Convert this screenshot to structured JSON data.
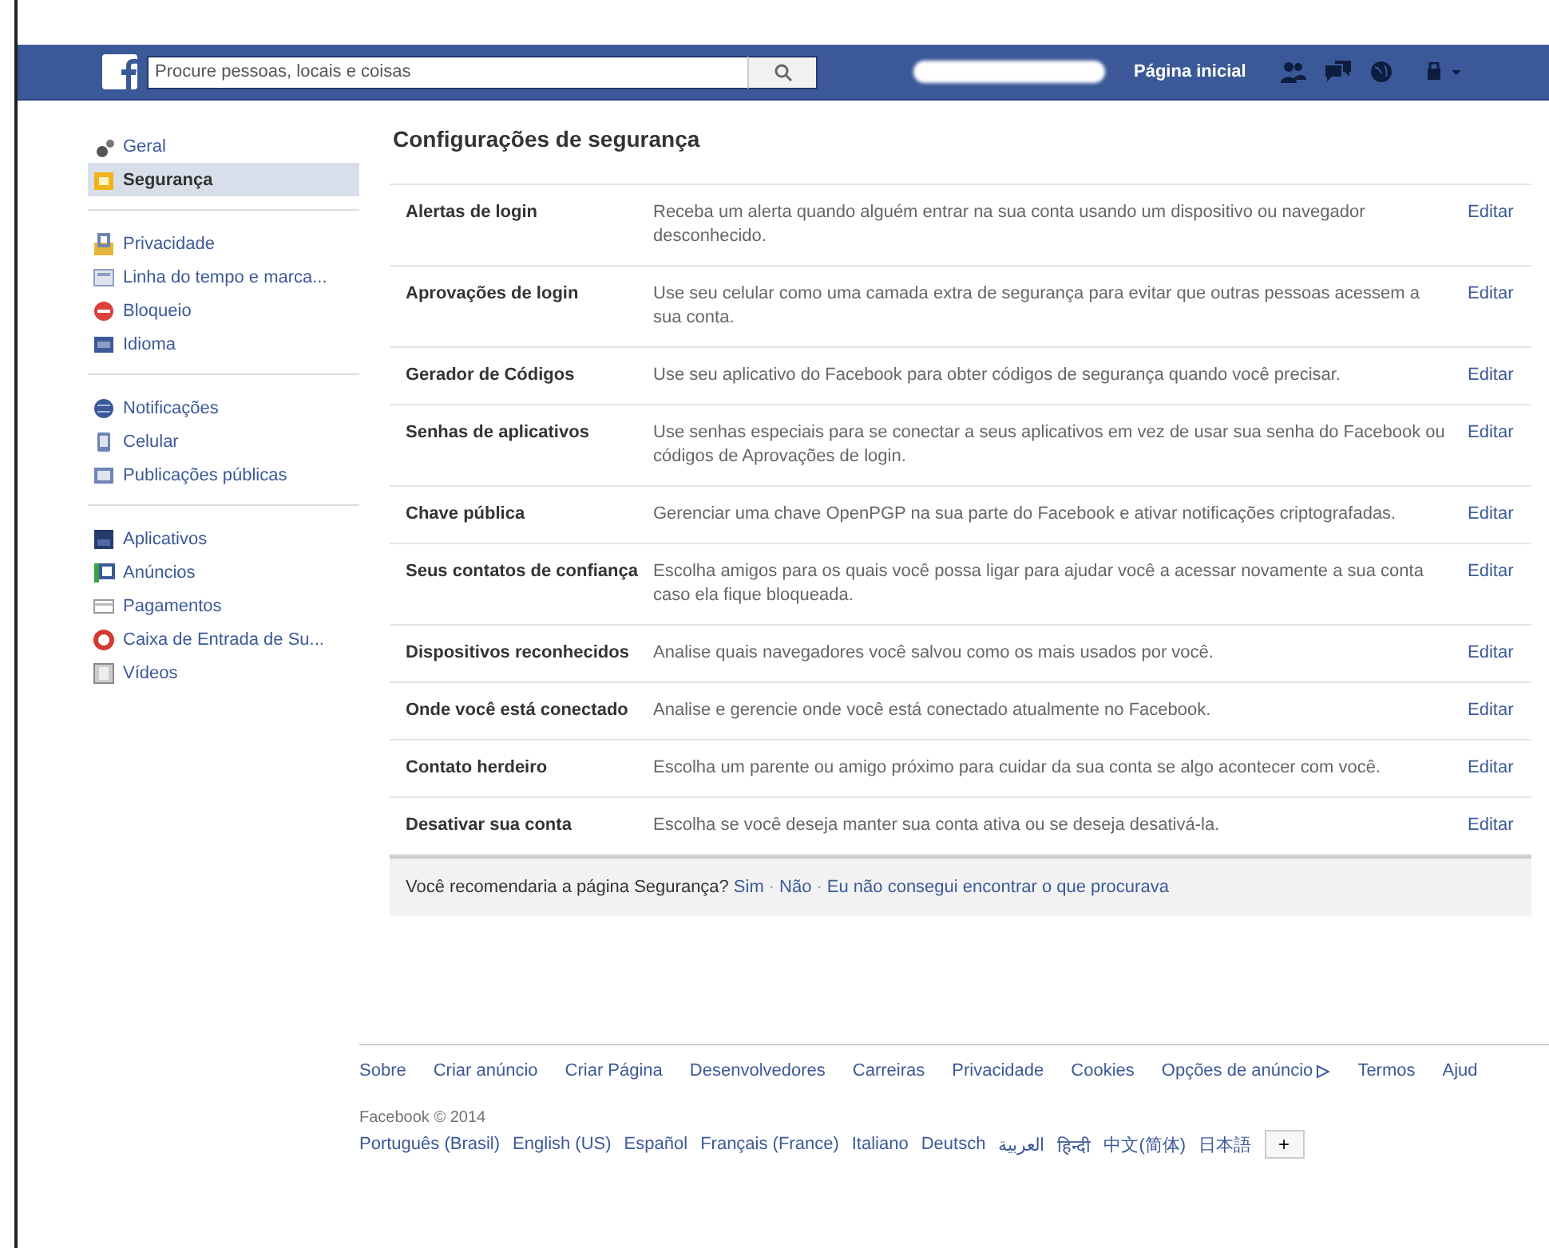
{
  "top_bar": {
    "search": {
      "placeholder": "Procure pessoas, locais e coisas"
    },
    "nav_link": "Página inicial"
  },
  "sidebar": {
    "groups": [
      {
        "items": [
          {
            "label": "Geral",
            "selected": false
          },
          {
            "label": "Segurança",
            "selected": true
          }
        ]
      },
      {
        "items": [
          {
            "label": "Privacidade",
            "selected": false
          },
          {
            "label": "Linha do tempo e marca...",
            "selected": false
          },
          {
            "label": "Bloqueio",
            "selected": false
          },
          {
            "label": "Idioma",
            "selected": false
          }
        ]
      },
      {
        "items": [
          {
            "label": "Notificações",
            "selected": false
          },
          {
            "label": "Celular",
            "selected": false
          },
          {
            "label": "Publicações públicas",
            "selected": false
          }
        ]
      },
      {
        "items": [
          {
            "label": "Aplicativos",
            "selected": false
          },
          {
            "label": "Anúncios",
            "selected": false
          },
          {
            "label": "Pagamentos",
            "selected": false
          },
          {
            "label": "Caixa de Entrada de Su...",
            "selected": false
          },
          {
            "label": "Vídeos",
            "selected": false
          }
        ]
      }
    ]
  },
  "content": {
    "title": "Configurações de segurança",
    "settings": [
      {
        "name": "Alertas de login",
        "description": "Receba um alerta quando alguém entrar na sua conta usando um dispositivo ou navegador desconhecido.",
        "action": "Editar"
      },
      {
        "name": "Aprovações de login",
        "description": "Use seu celular como uma camada extra de segurança para evitar que outras pessoas acessem a sua conta.",
        "action": "Editar"
      },
      {
        "name": "Gerador de Códigos",
        "description": "Use seu aplicativo do Facebook para obter códigos de segurança quando você precisar.",
        "action": "Editar"
      },
      {
        "name": "Senhas de aplicativos",
        "description": "Use senhas especiais para se conectar a seus aplicativos em vez de usar sua senha do Facebook ou códigos de Aprovações de login.",
        "action": "Editar"
      },
      {
        "name": "Chave pública",
        "description": "Gerenciar uma chave OpenPGP na sua parte do Facebook e ativar notificações criptografadas.",
        "action": "Editar"
      },
      {
        "name": "Seus contatos de confiança",
        "description": "Escolha amigos para os quais você possa ligar para ajudar você a acessar novamente a sua conta caso ela fique bloqueada.",
        "action": "Editar"
      },
      {
        "name": "Dispositivos reconhecidos",
        "description": "Analise quais navegadores você salvou como os mais usados por você.",
        "action": "Editar"
      },
      {
        "name": "Onde você está conectado",
        "description": "Analise e gerencie onde você está conectado atualmente no Facebook.",
        "action": "Editar"
      },
      {
        "name": "Contato herdeiro",
        "description": "Escolha um parente ou amigo próximo para cuidar da sua conta se algo acontecer com você.",
        "action": "Editar"
      },
      {
        "name": "Desativar sua conta",
        "description": "Escolha se você deseja manter sua conta ativa ou se deseja desativá-la.",
        "action": "Editar"
      }
    ],
    "feedback": {
      "question": "Você recomendaria a página Segurança?",
      "options": [
        "Sim",
        "Não",
        "Eu não consegui encontrar o que procurava"
      ],
      "separators": [
        "·",
        "·"
      ]
    }
  },
  "footer": {
    "links": [
      {
        "label": "Sobre",
        "kind": "plain"
      },
      {
        "label": "Criar anúncio",
        "kind": "plain"
      },
      {
        "label": "Criar Página",
        "kind": "plain"
      },
      {
        "label": "Desenvolvedores",
        "kind": "plain"
      },
      {
        "label": "Carreiras",
        "kind": "plain"
      },
      {
        "label": "Privacidade",
        "kind": "plain"
      },
      {
        "label": "Cookies",
        "kind": "plain"
      },
      {
        "label": "Opções de anúncio",
        "kind": "iconed"
      },
      {
        "label": "Termos",
        "kind": "plain"
      },
      {
        "label": "Ajud",
        "kind": "plain"
      }
    ],
    "copyright": "Facebook © 2014",
    "languages": [
      "Português (Brasil)",
      "English (US)",
      "Español",
      "Français (France)",
      "Italiano",
      "Deutsch",
      "العربية",
      "हिन्दी",
      "中文(简体)",
      "日本語"
    ],
    "more_button": "+"
  }
}
